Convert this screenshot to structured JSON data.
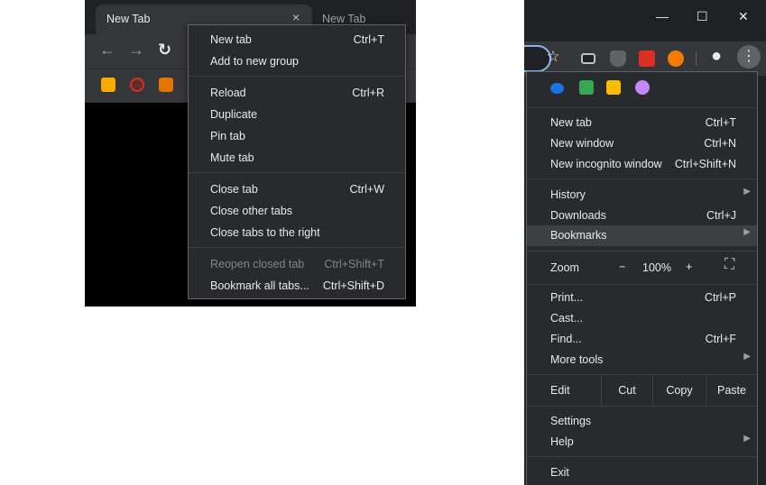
{
  "left": {
    "tabs": [
      {
        "title": "New Tab",
        "close": "×"
      },
      {
        "title": "New Tab"
      }
    ],
    "nav": {
      "back": "←",
      "forward": "→",
      "reload": "↻"
    },
    "menu": {
      "items": [
        {
          "label": "New tab",
          "accel": "Ctrl+T"
        },
        {
          "label": "Add to new group",
          "accel": ""
        },
        {
          "label": "Reload",
          "accel": "Ctrl+R"
        },
        {
          "label": "Duplicate",
          "accel": ""
        },
        {
          "label": "Pin tab",
          "accel": ""
        },
        {
          "label": "Mute tab",
          "accel": ""
        },
        {
          "label": "Close tab",
          "accel": "Ctrl+W"
        },
        {
          "label": "Close other tabs",
          "accel": ""
        },
        {
          "label": "Close tabs to the right",
          "accel": ""
        },
        {
          "label": "Reopen closed tab",
          "accel": "Ctrl+Shift+T",
          "disabled": true
        },
        {
          "label": "Bookmark all tabs...",
          "accel": "Ctrl+Shift+D"
        }
      ]
    },
    "bookmark_icons": [
      "camera-extension-icon",
      "record-extension-icon",
      "image-extension-icon"
    ]
  },
  "right": {
    "window_controls": {
      "minimize": "—",
      "maximize": "☐",
      "close": "✕"
    },
    "toolbar_icons": {
      "star": "☆",
      "profile": "●",
      "menu": "⋮"
    },
    "menu": {
      "new_tab": {
        "label": "New tab",
        "accel": "Ctrl+T"
      },
      "new_window": {
        "label": "New window",
        "accel": "Ctrl+N"
      },
      "incognito": {
        "label": "New incognito window",
        "accel": "Ctrl+Shift+N"
      },
      "history": {
        "label": "History"
      },
      "downloads": {
        "label": "Downloads",
        "accel": "Ctrl+J"
      },
      "bookmarks": {
        "label": "Bookmarks"
      },
      "zoom": {
        "label": "Zoom",
        "minus": "−",
        "value": "100%",
        "plus": "+",
        "fullscreen": "⛶"
      },
      "print": {
        "label": "Print...",
        "accel": "Ctrl+P"
      },
      "cast": {
        "label": "Cast..."
      },
      "find": {
        "label": "Find...",
        "accel": "Ctrl+F"
      },
      "more_tools": {
        "label": "More tools"
      },
      "edit": {
        "label": "Edit",
        "cut": "Cut",
        "copy": "Copy",
        "paste": "Paste"
      },
      "settings": {
        "label": "Settings"
      },
      "help": {
        "label": "Help"
      },
      "exit": {
        "label": "Exit"
      },
      "submenu_arrow": "▶"
    }
  },
  "colors": {
    "menu_bg": "#292a2d",
    "menu_text": "#e8eaed",
    "disabled_text": "#80868b",
    "highlight": "#3c4043",
    "focus_ring": "#8ab4f8"
  }
}
